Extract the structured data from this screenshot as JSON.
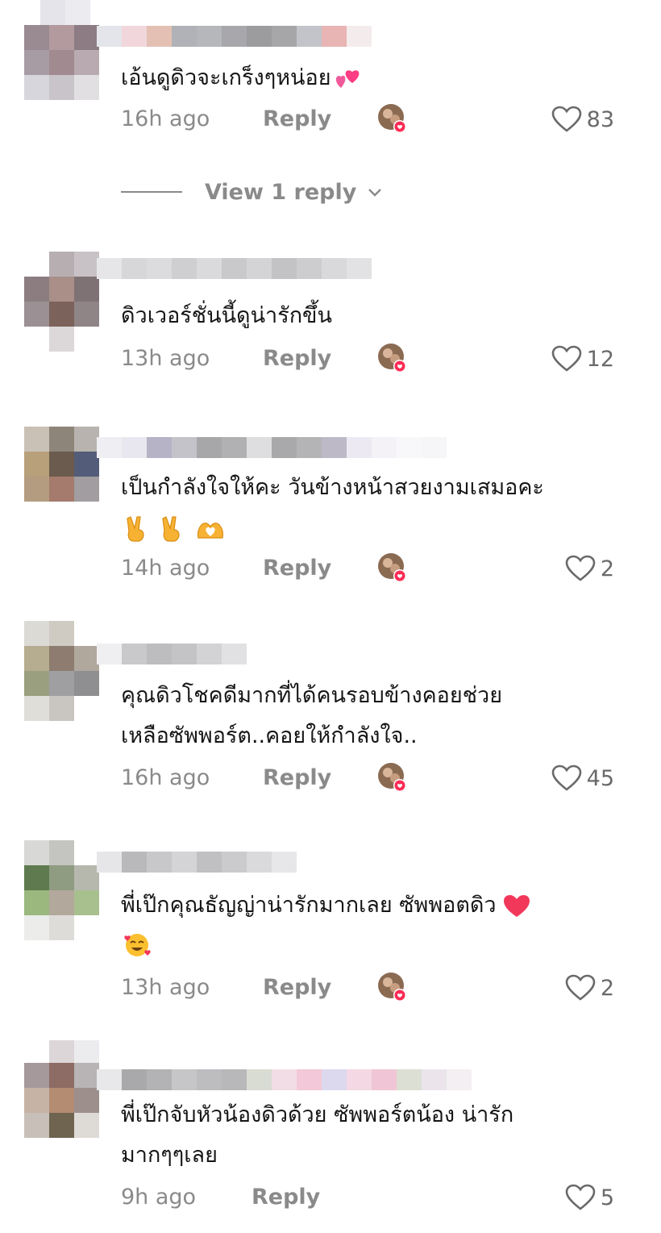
{
  "comments": [
    {
      "text": "เอ้นดูดิวจะเกร็งๆหน่อย",
      "emoji": [
        "two-hearts"
      ],
      "time": "16h ago",
      "reply_label": "Reply",
      "likes": "83",
      "creator_liked": true
    },
    {
      "text": "ดิวเวอร์ชั่นนี้ดูน่ารักขึ้น",
      "emoji": [],
      "time": "13h ago",
      "reply_label": "Reply",
      "likes": "12",
      "creator_liked": true
    },
    {
      "text": "เป็นกำลังใจให้คะ วันข้างหน้าสวยงามเสมอคะ",
      "emoji": [
        "victory-hand",
        "victory-hand",
        "heart-hands"
      ],
      "time": "14h ago",
      "reply_label": "Reply",
      "likes": "2",
      "creator_liked": true
    },
    {
      "text": "คุณดิวโชคดีมากที่ได้คนรอบข้างคอยช่วย\nเหลือซัพพอร์ต..คอยให้กำลังใจ..",
      "emoji": [],
      "time": "16h ago",
      "reply_label": "Reply",
      "likes": "45",
      "creator_liked": true
    },
    {
      "text": "พี่เป๊กคุณธัญญ่าน่ารักมากเลย ซัพพอตดิว",
      "emoji": [
        "red-heart",
        "smiling-face-with-hearts"
      ],
      "time": "13h ago",
      "reply_label": "Reply",
      "likes": "2",
      "creator_liked": true
    },
    {
      "text": "พี่เป๊กจับหัวน้องดิวด้วย ซัพพอร์ตน้อง น่ารัก\nมากๆๆเลย",
      "emoji": [],
      "time": "9h ago",
      "reply_label": "Reply",
      "likes": "5",
      "creator_liked": false
    }
  ],
  "view_replies": {
    "label": "View 1 reply",
    "icon": "chevron-down-icon"
  },
  "icons": {
    "like": "heart-outline-icon",
    "creator_like": "creator-avatar-heart-badge"
  },
  "colors": {
    "muted": "#8a8a8a",
    "text": "#161616",
    "badge": "#fe2c55"
  }
}
